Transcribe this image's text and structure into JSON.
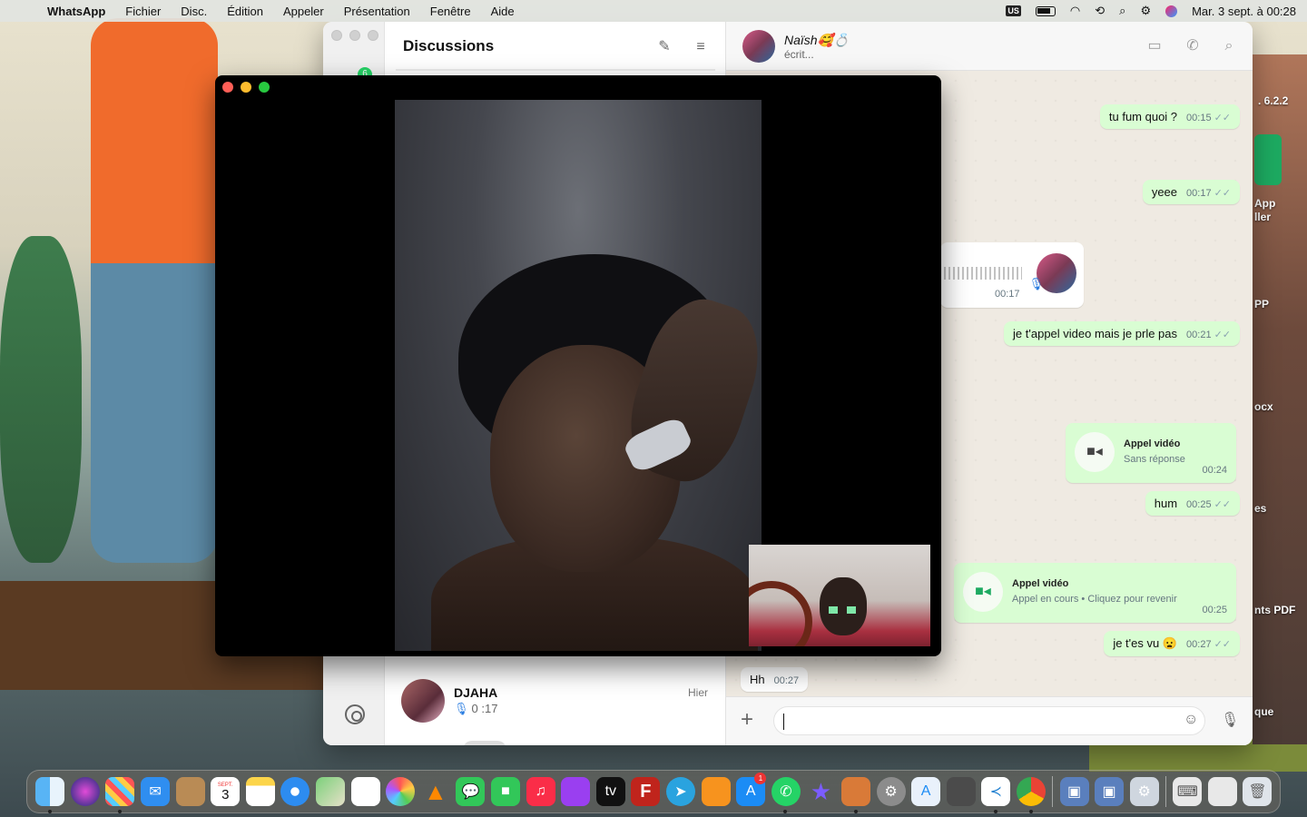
{
  "menubar": {
    "app": "WhatsApp",
    "items": [
      "Fichier",
      "Disc.",
      "Édition",
      "Appeler",
      "Présentation",
      "Fenêtre",
      "Aide"
    ],
    "keyboard": "US",
    "datetime": "Mar. 3 sept. à  00:28"
  },
  "sidebar": {
    "badge": "6"
  },
  "list": {
    "title": "Discussions",
    "chat": {
      "name": "DJAHA",
      "time": "Hier",
      "preview": "0 :17"
    }
  },
  "conversation": {
    "contact_name": "Naïsh🥰💍",
    "status": "écrit...",
    "messages": [
      {
        "text": "tu fum quoi ?",
        "time": "00:15"
      },
      {
        "text": "yeee",
        "time": "00:17"
      },
      {
        "voice_time": "00:17"
      },
      {
        "text": "je t'appel video mais je prle pas",
        "time": "00:21"
      },
      {
        "call_title": "Appel vidéo",
        "call_sub": "Sans réponse",
        "time": "00:24"
      },
      {
        "text": "hum",
        "time": "00:25"
      },
      {
        "call_title": "Appel vidéo",
        "call_sub": "Appel en cours • Cliquez pour revenir",
        "time": "00:25"
      },
      {
        "text": "je t'es vu 😦",
        "time": "00:27"
      },
      {
        "text": "Hh",
        "time": "00:27"
      }
    ],
    "composer_value": ""
  },
  "desktop": {
    "labels": [
      ". 6.2.2",
      "App",
      "ller",
      "PP",
      "ocx",
      "es",
      "nts PDF",
      "que"
    ]
  },
  "dock": {
    "apps": [
      "finder",
      "siri",
      "launchpad",
      "mail",
      "contacts",
      "calendar",
      "notes",
      "safari",
      "maps",
      "reminders",
      "photos",
      "vlc",
      "messages",
      "facetime",
      "music",
      "podcasts",
      "tv",
      "filezilla",
      "telegram",
      "books",
      "app-store",
      "whatsapp",
      "imovie",
      "preview",
      "system-settings",
      "xcode",
      "game",
      "vscode",
      "chrome",
      "virtualbox",
      "virtualbox-2",
      "utility",
      "keyboard",
      "window",
      "trash"
    ],
    "calendar_day": "3",
    "calendar_month": "SEPT.",
    "appstore_badge": "1"
  }
}
